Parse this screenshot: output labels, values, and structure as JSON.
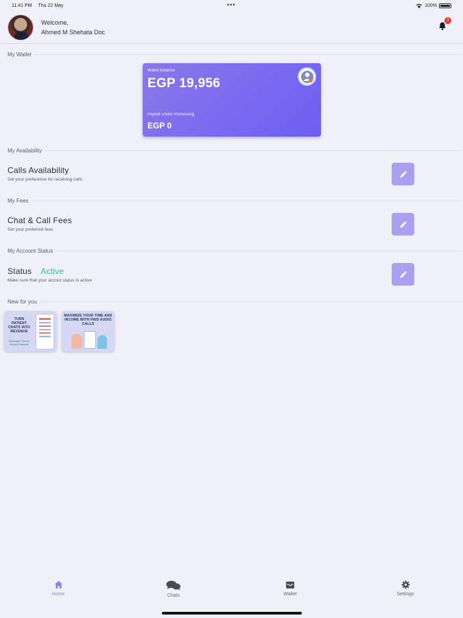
{
  "status_bar": {
    "time": "11:41 PM",
    "date": "Thu 22 May",
    "battery": "100%"
  },
  "header": {
    "welcome": "Welcome,",
    "user_name": "Ahmed M Shehata Doc",
    "notification_count": "2"
  },
  "wallet": {
    "section_label": "My Wallet",
    "balance_label": "Wallet Balance",
    "balance": "EGP 19,956",
    "payout_label": "Payout Under Processing",
    "payout": "EGP 0"
  },
  "availability": {
    "section_label": "My Availability",
    "title": "Calls Availability",
    "subtitle": "Set your preference for receiving calls"
  },
  "fees": {
    "section_label": "My Fees",
    "title": "Chat & Call Fees",
    "subtitle": "Set your preferred fees"
  },
  "account": {
    "section_label": "My Account Status",
    "title": "Status",
    "status_value": "Active",
    "subtitle": "Make sure that your accout status is active"
  },
  "new_for_you": {
    "section_label": "New for you",
    "cards": [
      {
        "headline": "TURN PATIENT CHATS INTO REVENUE",
        "tagline": "Message Clients Reach Patients"
      },
      {
        "headline": "MAXIMIZE YOUR TIME AND INCOME WITH PAID AUDIO CALLS"
      }
    ]
  },
  "nav": {
    "items": [
      {
        "label": "Home",
        "icon": "home-icon"
      },
      {
        "label": "Chats",
        "icon": "chats-icon"
      },
      {
        "label": "Wallet",
        "icon": "wallet-icon"
      },
      {
        "label": "Settings",
        "icon": "gear-icon"
      }
    ],
    "active": "Home"
  },
  "colors": {
    "accent": "#7b6af0",
    "edit_button": "#a9a1ef",
    "active_status": "#2fbf8f",
    "background": "#f0f1f8"
  }
}
